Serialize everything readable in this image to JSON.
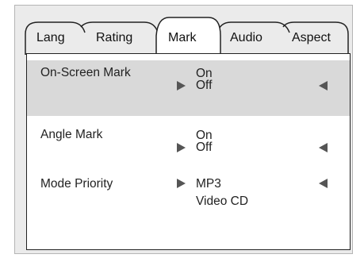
{
  "tabs": [
    "Lang",
    "Rating",
    "Mark",
    "Audio",
    "Aspect"
  ],
  "active_tab": "Mark",
  "settings": [
    {
      "label": "On-Screen Mark",
      "options": [
        "On",
        "Off"
      ],
      "selected": "Off",
      "highlighted": true
    },
    {
      "label": "Angle Mark",
      "options": [
        "On",
        "Off"
      ],
      "selected": "Off",
      "highlighted": false
    },
    {
      "label": "Mode Priority",
      "options": [
        "MP3",
        "Video CD"
      ],
      "selected": "MP3",
      "highlighted": false
    }
  ],
  "colors": {
    "highlight": "#d9d9d9",
    "arrow": "#555555",
    "border": "#222222",
    "frame": "#ebebeb"
  }
}
